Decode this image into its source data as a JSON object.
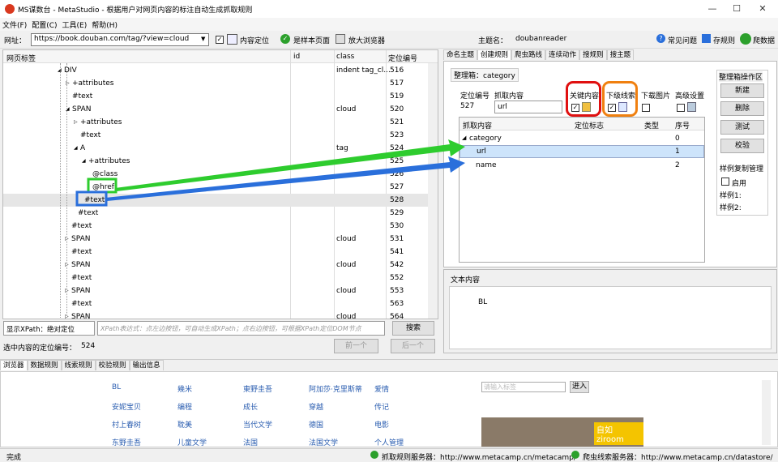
{
  "window": {
    "title": "MS谋数台 - MetaStudio - 根据用户对网页内容的标注自动生成抓取规则",
    "min": "—",
    "max": "☐",
    "close": "✕"
  },
  "menu": [
    "文件(F)",
    "配置(C)",
    "工具(E)",
    "帮助(H)"
  ],
  "toolbar": {
    "url_label": "网址：",
    "url": "https://book.douban.com/tag/?view=cloud",
    "locate_label": "内容定位",
    "sample_label": "是样本页面",
    "browser_label": "放大浏览器",
    "theme_label": "主题名：",
    "theme": "doubanreader",
    "faq": "常见问题",
    "save": "存规则",
    "crawl": "爬数据"
  },
  "tree": {
    "headers": [
      "网页标签",
      "id",
      "class",
      "定位编号"
    ],
    "rows": [
      {
        "label": "DIV",
        "cls": "indent tag_cl...",
        "num": "516",
        "ind": 75,
        "arrow": "◢"
      },
      {
        "label": "+attributes",
        "cls": "",
        "num": "517",
        "ind": 85,
        "arrow": "▷"
      },
      {
        "label": "#text",
        "cls": "",
        "num": "519",
        "ind": 85,
        "arrow": ""
      },
      {
        "label": "SPAN",
        "cls": "cloud",
        "num": "520",
        "ind": 85,
        "arrow": "◢"
      },
      {
        "label": "+attributes",
        "cls": "",
        "num": "521",
        "ind": 95,
        "arrow": "▷"
      },
      {
        "label": "#text",
        "cls": "",
        "num": "523",
        "ind": 95,
        "arrow": ""
      },
      {
        "label": "A",
        "cls": "tag",
        "num": "524",
        "ind": 95,
        "arrow": "◢"
      },
      {
        "label": "+attributes",
        "cls": "",
        "num": "525",
        "ind": 105,
        "arrow": "◢"
      },
      {
        "label": "@class",
        "cls": "",
        "num": "526",
        "ind": 110,
        "arrow": ""
      },
      {
        "label": "@href",
        "cls": "",
        "num": "527",
        "ind": 110,
        "arrow": ""
      },
      {
        "label": "#text",
        "cls": "",
        "num": "528",
        "ind": 100,
        "arrow": ""
      },
      {
        "label": "#text",
        "cls": "",
        "num": "529",
        "ind": 92,
        "arrow": ""
      },
      {
        "label": "#text",
        "cls": "",
        "num": "530",
        "ind": 84,
        "arrow": ""
      },
      {
        "label": "SPAN",
        "cls": "cloud",
        "num": "531",
        "ind": 84,
        "arrow": "▷"
      },
      {
        "label": "#text",
        "cls": "",
        "num": "541",
        "ind": 84,
        "arrow": ""
      },
      {
        "label": "SPAN",
        "cls": "cloud",
        "num": "542",
        "ind": 84,
        "arrow": "▷"
      },
      {
        "label": "#text",
        "cls": "",
        "num": "552",
        "ind": 84,
        "arrow": ""
      },
      {
        "label": "SPAN",
        "cls": "cloud",
        "num": "553",
        "ind": 84,
        "arrow": "▷"
      },
      {
        "label": "#text",
        "cls": "",
        "num": "563",
        "ind": 84,
        "arrow": ""
      },
      {
        "label": "SPAN",
        "cls": "cloud",
        "num": "564",
        "ind": 84,
        "arrow": "▷"
      }
    ]
  },
  "xpath": {
    "mode": "显示XPath：绝对定位",
    "placeholder": "XPath表达式：点左边按钮，可自动生成XPath；点右边按钮，可根据XPath定位DOM节点",
    "search": "搜索",
    "sel_label": "选中内容的定位编号：",
    "sel_value": "524",
    "prev": "前一个",
    "next": "后一个"
  },
  "rtabs": [
    "命名主题",
    "创建规则",
    "爬虫路线",
    "连续动作",
    "搜规则",
    "搜主题"
  ],
  "rule": {
    "box_label": "整理箱：category",
    "pos_label": "定位编号",
    "pos": "527",
    "grab_label": "抓取内容",
    "grab": "url",
    "key": "关键内容",
    "sub": "下级线索",
    "img": "下载图片",
    "adv": "高级设置",
    "cols": [
      "抓取内容",
      "定位标志",
      "类型",
      "序号"
    ],
    "rows": [
      {
        "name": "category",
        "n": "0"
      },
      {
        "name": "url",
        "n": "1"
      },
      {
        "name": "name",
        "n": "2"
      }
    ]
  },
  "ops": {
    "title": "整理箱操作区",
    "new": "新建",
    "del": "删除",
    "test": "测试",
    "check": "校验",
    "copy": "样例复制管理",
    "enable": "启用",
    "s1": "样例1:",
    "s2": "样例2:"
  },
  "text": {
    "title": "文本内容",
    "content": "BL"
  },
  "btabs": [
    "浏览器",
    "数据规则",
    "线索规则",
    "校验规则",
    "输出信息"
  ],
  "tags": [
    [
      "BL",
      "幾米",
      "東野圭吾",
      "阿加莎·克里斯蒂",
      "爱情"
    ],
    [
      "安妮宝贝",
      "编程",
      "成长",
      "穿越",
      "传记"
    ],
    [
      "村上春树",
      "耽美",
      "当代文学",
      "德国",
      "电影"
    ],
    [
      "东野圭吾",
      "儿童文学",
      "法国",
      "法国文学",
      "个人管理"
    ]
  ],
  "search_tag": "请输入标签",
  "enter": "进入",
  "ziroom": "自如 ziroom",
  "status": {
    "left": "完成",
    "s1": "抓取规则服务器：http://www.metacamp.cn/metacamp/",
    "s2": "爬虫线索服务器：http://www.metacamp.cn/datastore/"
  },
  "colors": {
    "green": "#2ecc2e",
    "blue": "#2a6fdb",
    "red": "#e01010",
    "orange": "#f08010"
  }
}
